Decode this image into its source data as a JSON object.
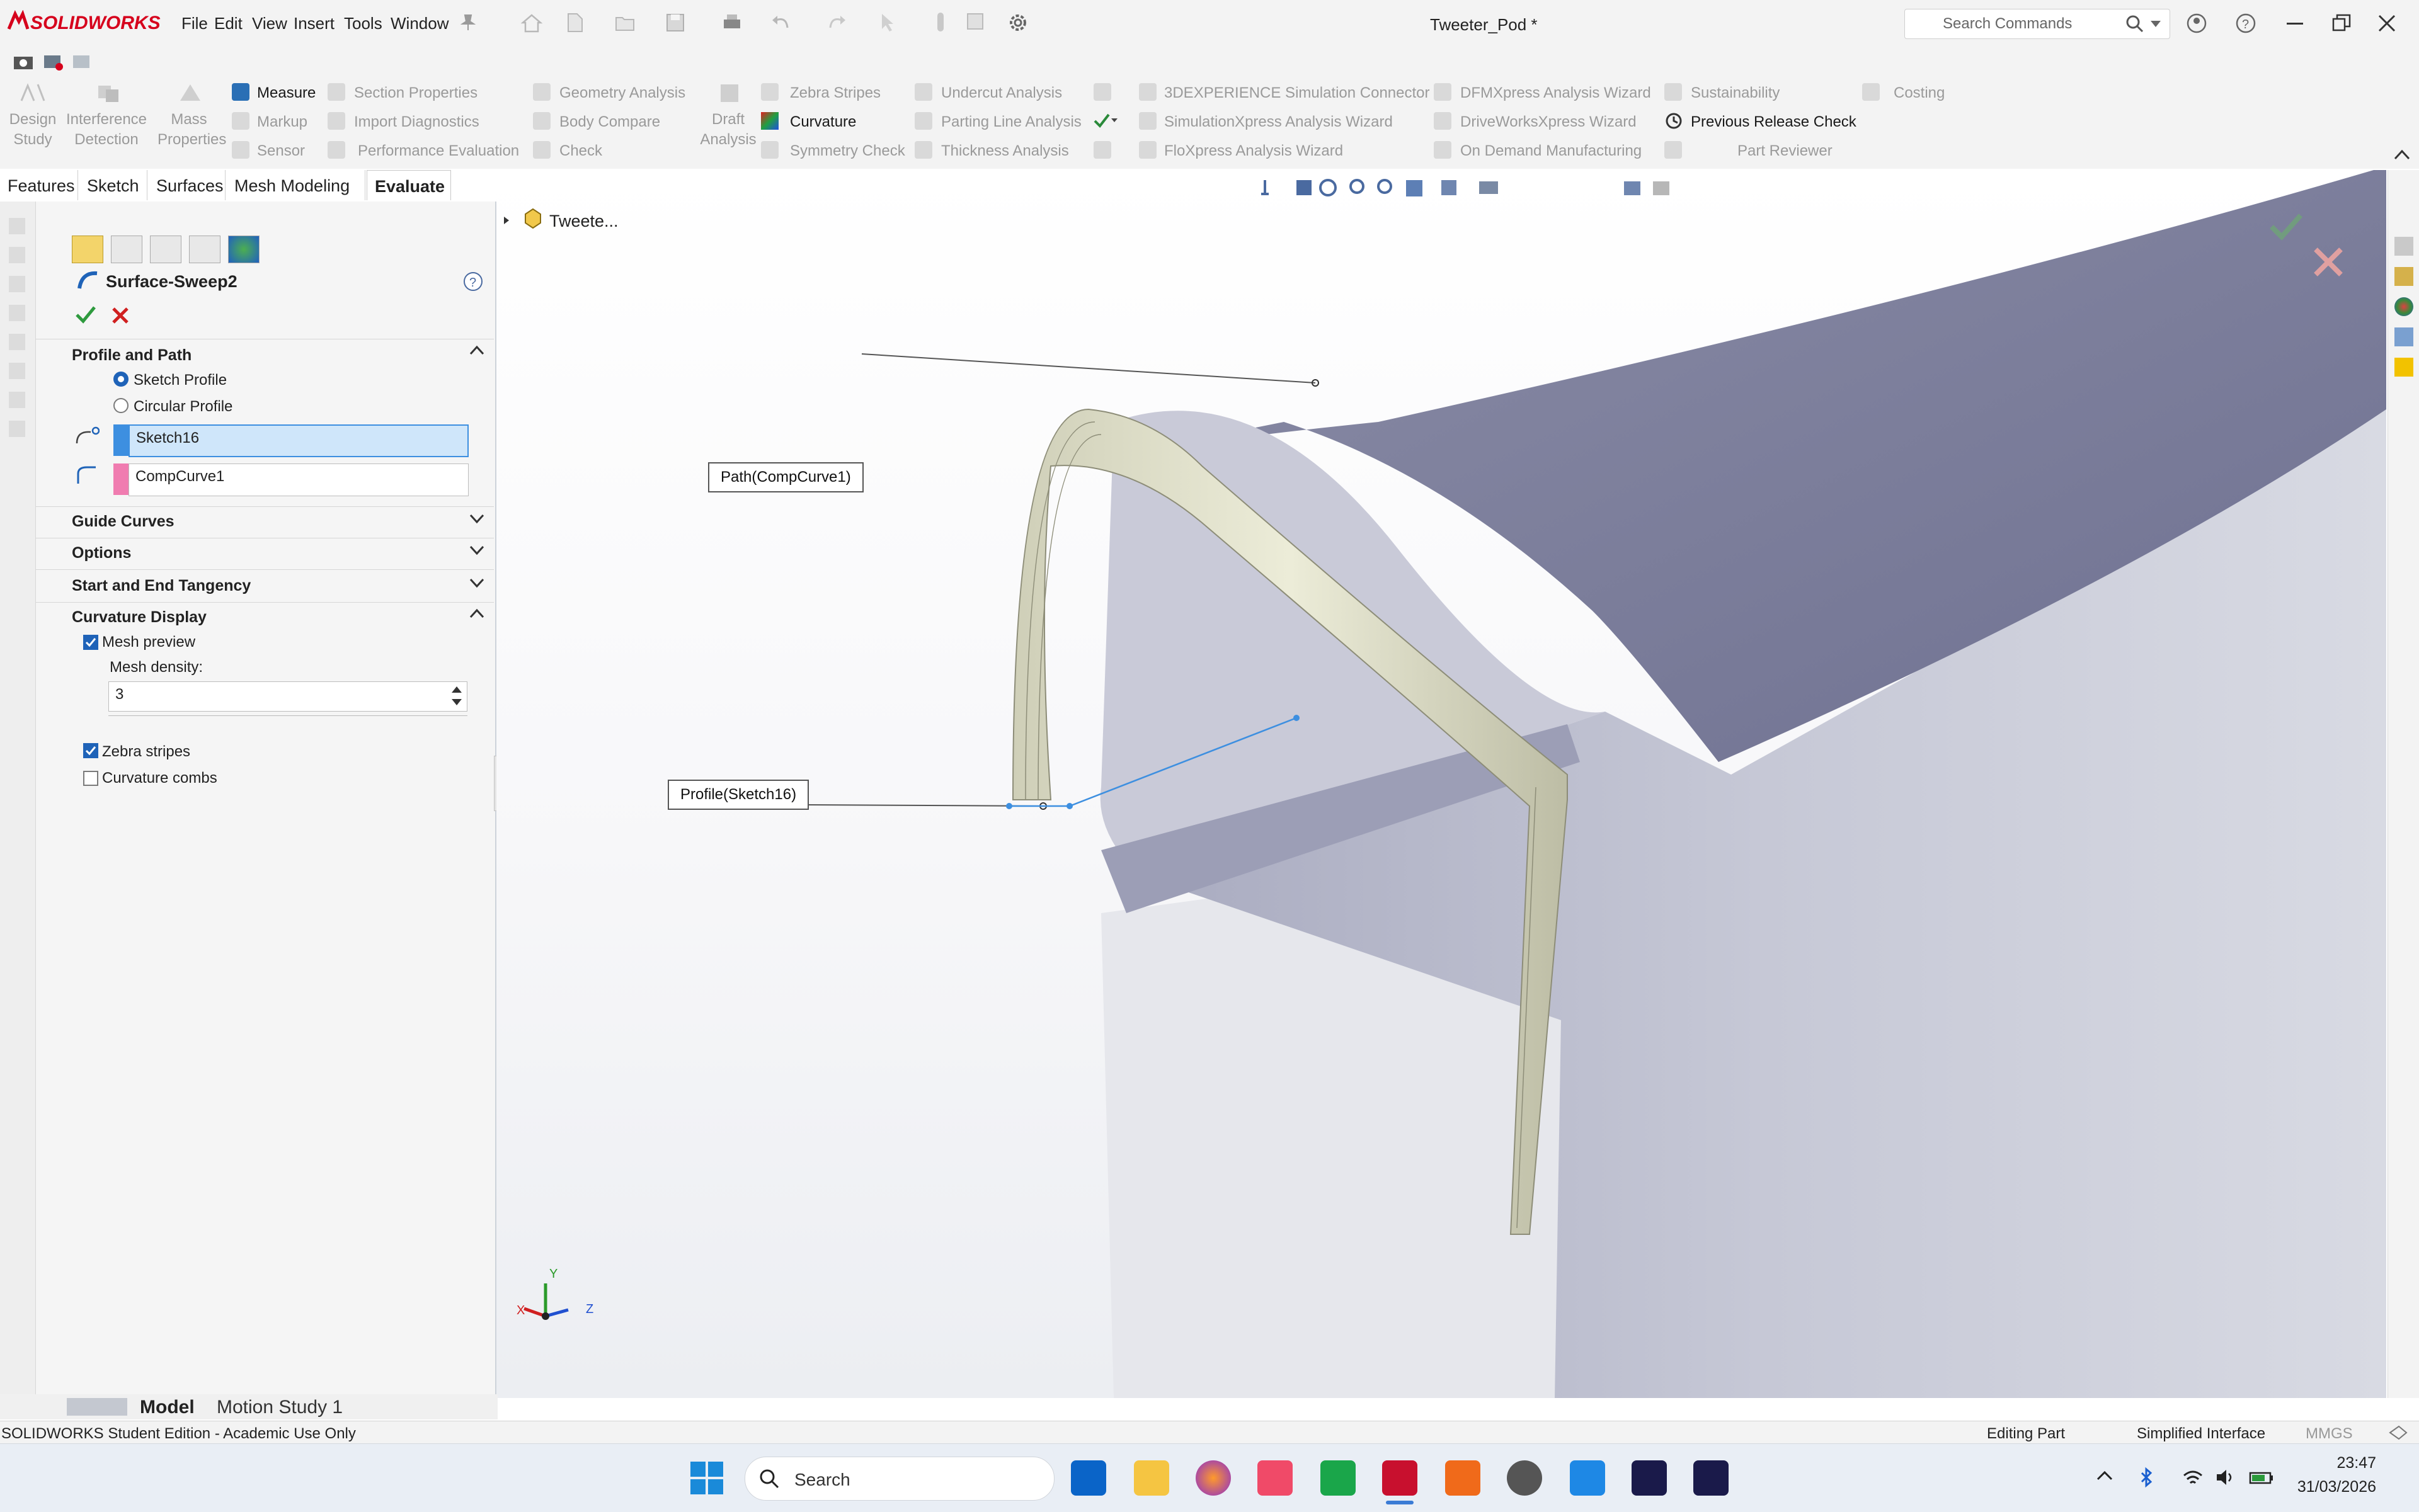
{
  "app": {
    "logo": "SOLIDWORKS",
    "title": "Tweeter_Pod *"
  },
  "menu": [
    "File",
    "Edit",
    "View",
    "Insert",
    "Tools",
    "Window"
  ],
  "search": {
    "placeholder": "Search Commands"
  },
  "commands": {
    "design_study": "Design Study",
    "interference": "Interference Detection",
    "mass_properties": "Mass Properties",
    "measure": "Measure",
    "markup": "Markup",
    "sensor": "Sensor",
    "section_properties": "Section Properties",
    "import_diagnostics": "Import Diagnostics",
    "performance_evaluation": "Performance Evaluation",
    "geometry_analysis": "Geometry Analysis",
    "body_compare": "Body Compare",
    "check": "Check",
    "draft_analysis": "Draft Analysis",
    "zebra_stripes": "Zebra Stripes",
    "curvature": "Curvature",
    "symmetry_check": "Symmetry Check",
    "undercut_analysis": "Undercut Analysis",
    "parting_line_analysis": "Parting Line Analysis",
    "thickness_analysis": "Thickness Analysis",
    "simulation_connector": "3DEXPERIENCE Simulation Connector",
    "simulationxpress": "SimulationXpress Analysis Wizard",
    "floxpress": "FloXpress Analysis Wizard",
    "dfmxpress": "DFMXpress Analysis Wizard",
    "driveworksxpress": "DriveWorksXpress Wizard",
    "on_demand": "On Demand Manufacturing",
    "sustainability": "Sustainability",
    "previous_release": "Previous Release Check",
    "part_reviewer": "Part Reviewer",
    "costing": "Costing"
  },
  "tabs": [
    "Features",
    "Sketch",
    "Surfaces",
    "Mesh Modeling",
    "Evaluate"
  ],
  "feature": {
    "name": "Surface-Sweep2",
    "profile_path_title": "Profile and Path",
    "sketch_profile": "Sketch Profile",
    "circular_profile": "Circular Profile",
    "profile_value": "Sketch16",
    "path_value": "CompCurve1",
    "guide_curves": "Guide Curves",
    "options": "Options",
    "tangency": "Start and End Tangency",
    "curvature_display": "Curvature Display",
    "mesh_preview": "Mesh preview",
    "mesh_density_label": "Mesh density:",
    "mesh_density": "3",
    "zebra_stripes": "Zebra stripes",
    "curvature_combs": "Curvature combs"
  },
  "viewport": {
    "tree_root": "Tweete...",
    "path_callout": "Path(CompCurve1)",
    "profile_callout": "Profile(Sketch16)",
    "axis_x": "X",
    "axis_y": "Y",
    "axis_z": "Z"
  },
  "bottom_tabs": [
    "Model",
    "Motion Study 1"
  ],
  "status": {
    "edition": "SOLIDWORKS Student Edition - Academic Use Only",
    "mode": "Editing Part",
    "interface": "Simplified Interface",
    "units": "MMGS"
  },
  "taskbar": {
    "search": "Search",
    "time": "23:47",
    "date": "31/03/2026"
  },
  "colors": {
    "brand": "#d6001c",
    "accent": "#1f63b8",
    "selection": "#cfe6fa",
    "path_swatch": "#f07cb0",
    "profile_swatch": "#3d8fe0"
  }
}
